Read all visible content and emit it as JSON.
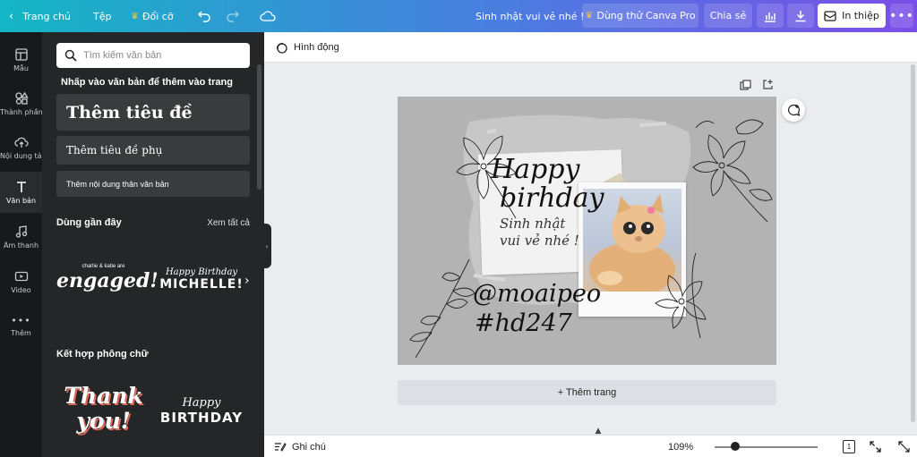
{
  "topbar": {
    "home": "Trang chủ",
    "file": "Tệp",
    "resize": "Đổi cỡ",
    "doc_title": "Sinh nhật vui vẻ nhé !",
    "try_pro": "Dùng thử Canva Pro",
    "share": "Chia sẻ",
    "print": "In thiệp"
  },
  "rail": {
    "items": [
      {
        "label": "Mẫu"
      },
      {
        "label": "Thành phần"
      },
      {
        "label": "Nội dung tải lên"
      },
      {
        "label": "Văn bản"
      },
      {
        "label": "Âm thanh"
      },
      {
        "label": "Video"
      },
      {
        "label": "Thêm"
      }
    ]
  },
  "panel": {
    "search_placeholder": "Tìm kiếm văn bản",
    "hint": "Nhấp vào văn bản để thêm vào trang",
    "heading": "Thêm tiêu đề",
    "subheading": "Thêm tiêu đề phụ",
    "body": "Thêm nội dung thân văn bản",
    "recent_title": "Dùng gần đây",
    "see_all": "Xem tất cả",
    "recent": [
      {
        "small": "charlie & katie are",
        "big": "engaged!"
      },
      {
        "small": "Happy Birthday",
        "big": "MICHELLE!"
      }
    ],
    "combos_title": "Kết hợp phông chữ",
    "combos": [
      {
        "line1": "Thank",
        "line2": "you!"
      },
      {
        "line1": "Happy",
        "line2": "BIRTHDAY"
      }
    ]
  },
  "editor": {
    "animate": "Hình động",
    "add_page": "+ Thêm trang",
    "design": {
      "line1": "Happy",
      "line2": "birhday",
      "line3": "Sinh nhật",
      "line4": "vui vẻ nhé !",
      "handle": "@moaipeo",
      "tag": "#hd247"
    }
  },
  "bottombar": {
    "notes": "Ghi chú",
    "zoom": "109%",
    "page_count": "1"
  },
  "colors": {
    "accent_start": "#13b6c4",
    "accent_end": "#7b4ee8",
    "panel_bg": "#252627",
    "rail_bg": "#18191b",
    "canvas_bg": "#b3b3b3"
  }
}
